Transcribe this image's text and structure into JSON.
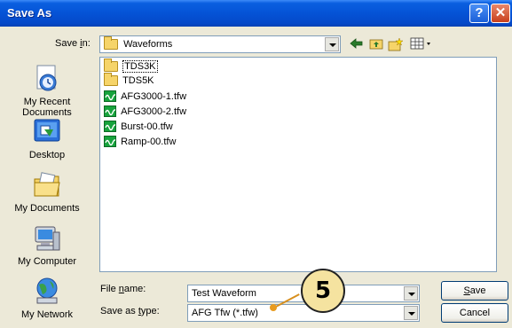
{
  "window": {
    "title": "Save As"
  },
  "titlebar": {
    "help_icon": "question-mark-icon",
    "close_icon": "close-x-icon",
    "help_glyph": "?",
    "close_glyph": "✕"
  },
  "save_in": {
    "label_pre": "Save ",
    "label_accel": "i",
    "label_post": "n:",
    "value": "Waveforms"
  },
  "toolbar": {
    "items": [
      "back-arrow-icon",
      "up-one-level-icon",
      "new-folder-icon",
      "view-menu-icon"
    ]
  },
  "places": [
    {
      "label": "My Recent Documents",
      "icon": "recent-documents-icon"
    },
    {
      "label": "Desktop",
      "icon": "desktop-icon"
    },
    {
      "label": "My Documents",
      "icon": "my-documents-icon"
    },
    {
      "label": "My Computer",
      "icon": "my-computer-icon"
    },
    {
      "label": "My Network",
      "icon": "my-network-icon"
    }
  ],
  "files": [
    {
      "name": "TDS3K",
      "type": "folder"
    },
    {
      "name": "TDS5K",
      "type": "folder"
    },
    {
      "name": "AFG3000-1.tfw",
      "type": "waveform"
    },
    {
      "name": "AFG3000-2.tfw",
      "type": "waveform"
    },
    {
      "name": "Burst-00.tfw",
      "type": "waveform"
    },
    {
      "name": "Ramp-00.tfw",
      "type": "waveform"
    }
  ],
  "file_name": {
    "label_pre": "File ",
    "label_accel": "n",
    "label_post": "ame:",
    "value": "Test Waveform"
  },
  "save_as_type": {
    "label_pre": "Save as ",
    "label_accel": "t",
    "label_post": "ype:",
    "value": "AFG Tfw (*.tfw)"
  },
  "buttons": {
    "save_accel": "S",
    "save_rest": "ave",
    "cancel": "Cancel"
  },
  "callout": {
    "number": "5"
  },
  "colors": {
    "titlebar": "#0553d6",
    "callout_fill": "#f5e3a0",
    "pointer": "#e89b1f",
    "waveform_icon": "#17a33d"
  }
}
